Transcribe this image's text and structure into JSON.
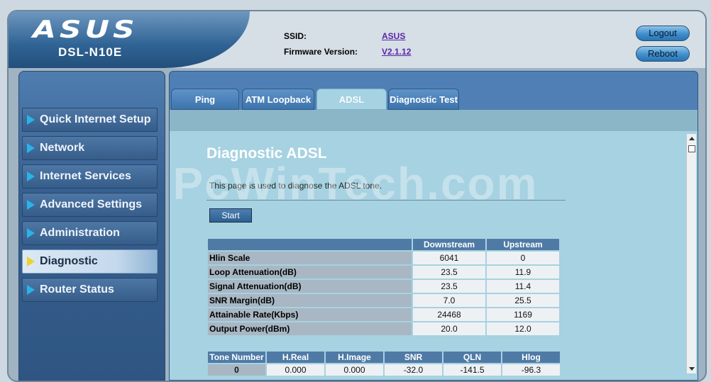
{
  "header": {
    "logo_text": "ASUS",
    "model": "DSL-N10E",
    "ssid_label": "SSID:",
    "ssid_value": "ASUS",
    "firmware_label": "Firmware Version:",
    "firmware_value": "V2.1.12",
    "logout_label": "Logout",
    "reboot_label": "Reboot"
  },
  "sidebar": {
    "items": [
      {
        "label": "Quick Internet Setup"
      },
      {
        "label": "Network"
      },
      {
        "label": "Internet Services"
      },
      {
        "label": "Advanced Settings"
      },
      {
        "label": "Administration"
      },
      {
        "label": "Diagnostic",
        "active": true
      },
      {
        "label": "Router Status"
      }
    ]
  },
  "tabs": [
    {
      "label": "Ping"
    },
    {
      "label": "ATM Loopback"
    },
    {
      "label": "ADSL",
      "active": true
    },
    {
      "label": "Diagnostic Test"
    }
  ],
  "main": {
    "title": "Diagnostic ADSL",
    "description": "This page is used to diagnose the ADSL tone.",
    "start_label": "Start"
  },
  "stats_table": {
    "headers": [
      "",
      "Downstream",
      "Upstream"
    ],
    "rows": [
      {
        "label": "Hlin Scale",
        "down": "6041",
        "up": "0"
      },
      {
        "label": "Loop Attenuation(dB)",
        "down": "23.5",
        "up": "11.9"
      },
      {
        "label": "Signal Attenuation(dB)",
        "down": "23.5",
        "up": "11.4"
      },
      {
        "label": "SNR Margin(dB)",
        "down": "7.0",
        "up": "25.5"
      },
      {
        "label": "Attainable Rate(Kbps)",
        "down": "24468",
        "up": "1169"
      },
      {
        "label": "Output Power(dBm)",
        "down": "20.0",
        "up": "12.0"
      }
    ]
  },
  "tone_table": {
    "headers": [
      "Tone Number",
      "H.Real",
      "H.Image",
      "SNR",
      "QLN",
      "Hlog"
    ],
    "rows": [
      [
        "0",
        "0.000",
        "0.000",
        "-32.0",
        "-141.5",
        "-96.3"
      ]
    ]
  },
  "watermark": "PcWinTech.com",
  "colors": {
    "accent": "#2ab3e8",
    "active_arrow": "#f0d12a",
    "panel": "#a6d2e1",
    "nav": "#365d8a"
  }
}
